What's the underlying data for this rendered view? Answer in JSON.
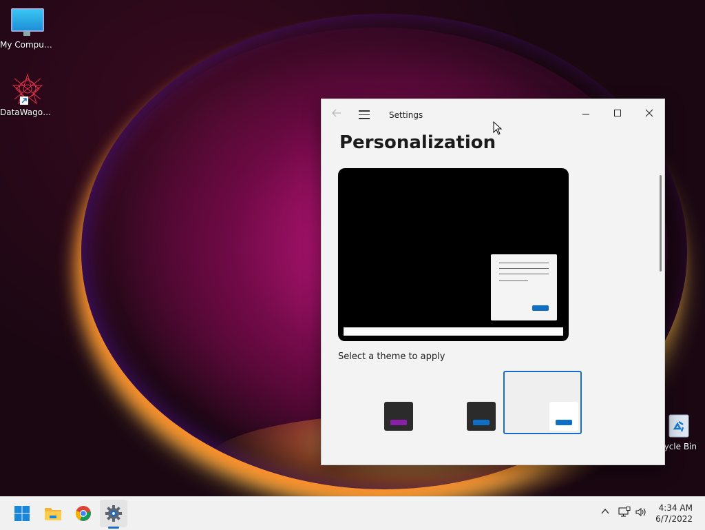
{
  "desktop": {
    "icons": [
      {
        "label": "My Computer"
      },
      {
        "label": "DataWagon..."
      }
    ],
    "recycle_bin_label": "cycle Bin"
  },
  "settings_window": {
    "title": "Settings",
    "page_title": "Personalization",
    "theme_section_label": "Select a theme to apply",
    "icons": {
      "back": "back-arrow-icon",
      "menu": "hamburger-menu-icon",
      "minimize": "minimize-icon",
      "maximize": "maximize-icon",
      "close": "close-icon"
    },
    "themes": [
      {
        "id": "theme-1",
        "card_color": "#2b2b2b",
        "accent": "#8a1fa8",
        "selected": false
      },
      {
        "id": "theme-2",
        "card_color": "#2b2b2b",
        "accent": "#0f6fc6",
        "selected": false
      },
      {
        "id": "theme-3",
        "card_color": "#ffffff",
        "accent": "#0f6fc6",
        "selected": true
      }
    ]
  },
  "taskbar": {
    "items": [
      "start-button",
      "file-explorer",
      "chrome",
      "settings"
    ],
    "clock": {
      "time": "4:34 AM",
      "date": "6/7/2022"
    },
    "tray_glyphs": {
      "chevron": "^",
      "network": "⎕",
      "volume": "🔊"
    }
  },
  "colors": {
    "accent": "#1b6cc8"
  }
}
